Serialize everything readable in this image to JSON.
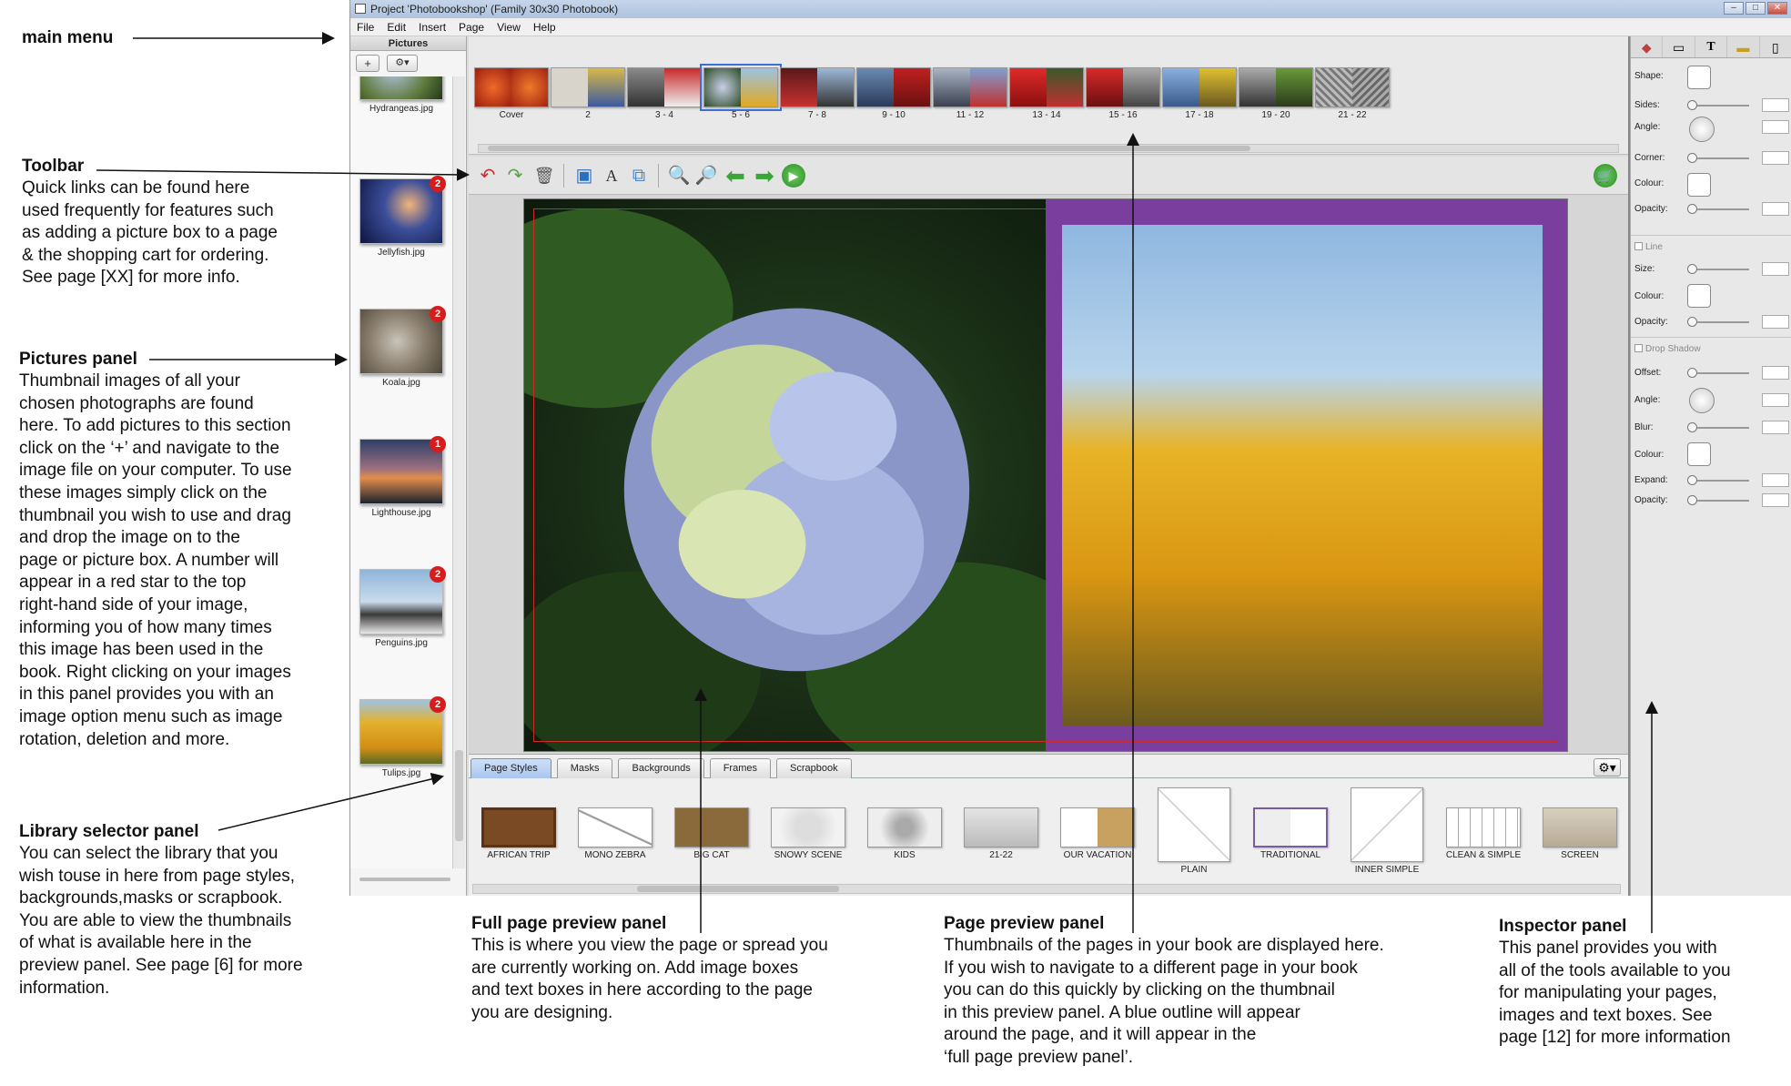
{
  "annotations": {
    "main_menu": {
      "title": "main menu"
    },
    "toolbar": {
      "title": "Toolbar",
      "body": "Quick links  can be found here\nused frequently for features such\nas adding a picture box to a page\n& the shopping cart for ordering.\nSee page [XX] for more info."
    },
    "pictures_panel": {
      "title": "Pictures panel",
      "body": "Thumbnail images of all your\nchosen photographs are found\nhere. To add pictures to this section\nclick on the ‘+’ and navigate to the\nimage file on your computer. To use\nthese images simply click on the\nthumbnail you wish to use and drag\nand drop the image on to the\npage or picture box. A number will\nappear in a red star to the top\nright-hand side of your image,\ninforming you of how many times\nthis image has been used in the\nbook. Right clicking on your images\nin this panel provides you with an\nimage option menu such as image\nrotation, deletion and more."
    },
    "library_selector": {
      "title": "Library selector panel",
      "body": "You can select the library that you\nwish touse in here from page styles,\n backgrounds,masks or scrapbook.\nYou are able to view the thumbnails\nof what is available here in the\npreview panel. See page [6] for more\ninformation."
    },
    "full_page_preview": {
      "title": "Full page preview panel",
      "body": "This is where you view the page or spread you\nare currently working on. Add image boxes\nand text boxes in here according to the page\nyou are designing."
    },
    "page_preview": {
      "title": "Page preview panel",
      "body": "Thumbnails of the pages in your book are displayed here.\nIf you wish to navigate to a different page in your book\nyou can do this quickly by clicking on the thumbnail\nin this preview panel. A blue outline will appear\naround the page, and it will appear in the\n‘full page preview panel’."
    },
    "inspector": {
      "title": "Inspector panel",
      "body": "This panel provides you with\nall of the tools available to you\nfor manipulating your pages,\nimages and text boxes. See\npage [12] for more information"
    }
  },
  "window": {
    "title": "Project 'Photobookshop' (Family 30x30 Photobook)",
    "menu": [
      "File",
      "Edit",
      "Insert",
      "Page",
      "View",
      "Help"
    ]
  },
  "pictures": {
    "header": "Pictures",
    "add_label": "+",
    "gear_label": "⚙▾",
    "items": [
      {
        "name": "Hydrangeas.jpg",
        "count": ""
      },
      {
        "name": "Jellyfish.jpg",
        "count": "2"
      },
      {
        "name": "Koala.jpg",
        "count": "2"
      },
      {
        "name": "Lighthouse.jpg",
        "count": "1"
      },
      {
        "name": "Penguins.jpg",
        "count": "2"
      },
      {
        "name": "Tulips.jpg",
        "count": "2"
      }
    ]
  },
  "pages": [
    {
      "label": "Cover"
    },
    {
      "label": "2"
    },
    {
      "label": "3 - 4"
    },
    {
      "label": "5 - 6"
    },
    {
      "label": "7 - 8"
    },
    {
      "label": "9 - 10"
    },
    {
      "label": "11 - 12"
    },
    {
      "label": "13 - 14"
    },
    {
      "label": "15 - 16"
    },
    {
      "label": "17 - 18"
    },
    {
      "label": "19 - 20"
    },
    {
      "label": "21 - 22"
    }
  ],
  "library": {
    "tabs": [
      "Page Styles",
      "Masks",
      "Backgrounds",
      "Frames",
      "Scrapbook"
    ],
    "active_tab": "Page Styles",
    "gear_label": "⚙▾",
    "items": [
      {
        "label": "AFRICAN TRIP"
      },
      {
        "label": "MONO ZEBRA"
      },
      {
        "label": "BIG CAT"
      },
      {
        "label": "SNOWY SCENE"
      },
      {
        "label": "KIDS"
      },
      {
        "label": "21-22"
      },
      {
        "label": "OUR VACATION"
      },
      {
        "label": "PLAIN"
      },
      {
        "label": "TRADITIONAL"
      },
      {
        "label": "INNER SIMPLE"
      },
      {
        "label": "CLEAN & SIMPLE"
      },
      {
        "label": "SCREEN"
      }
    ]
  },
  "inspector": {
    "shape": "Shape:",
    "sides": "Sides:",
    "angle": "Angle:",
    "corner": "Corner:",
    "colour": "Colour:",
    "opacity": "Opacity:",
    "line_section": "Line",
    "size": "Size:",
    "line_colour": "Colour:",
    "line_opacity": "Opacity:",
    "shadow_section": "Drop Shadow",
    "offset": "Offset:",
    "shadow_angle": "Angle:",
    "blur": "Blur:",
    "shadow_colour": "Colour:",
    "expand": "Expand:",
    "shadow_opacity": "Opacity:"
  },
  "colors": {
    "accent_selected": "#3a6fd8",
    "badge_red": "#d71c1c",
    "right_page_purple": "#7a3e9e",
    "active_tab_blue": "#a9c6ef"
  }
}
